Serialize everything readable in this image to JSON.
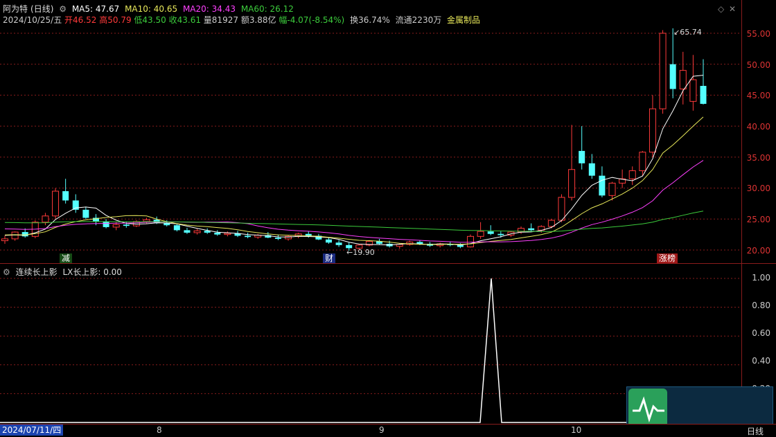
{
  "header": {
    "stock_name": "阿为特",
    "period": "(日线)",
    "ma5": "MA5: 47.67",
    "ma10": "MA10: 40.65",
    "ma20": "MA20: 34.43",
    "ma60": "MA60: 26.12",
    "date": "2024/10/25/五",
    "open": "开46.52",
    "high": "高50.79",
    "low": "低43.50",
    "close": "收43.61",
    "volume": "量81927",
    "amount": "额3.88亿",
    "change": "幅-4.07(-8.54%)",
    "turnover": "换36.74%",
    "float_shares": "流通2230万",
    "sector": "金属制品"
  },
  "price_axis": [
    "55.00",
    "50.00",
    "45.00",
    "40.00",
    "35.00",
    "30.00",
    "25.00",
    "20.00"
  ],
  "annotations": {
    "high_marker": "65.74",
    "low_marker": "19.90",
    "tag_jian": "减",
    "tag_cai": "财",
    "tag_zhangbang": "涨榜"
  },
  "indicator": {
    "title": "连续长上影",
    "lx_label": "LX长上影: 0.00",
    "axis": [
      "1.00",
      "0.80",
      "0.60",
      "0.40",
      "0.20"
    ]
  },
  "bottom_bar": {
    "start_date": "2024/07/11/四",
    "m8": "8",
    "m9": "9",
    "m10": "10",
    "period_btn": "日线"
  },
  "colors": {
    "up": "#ff3a3a",
    "down": "#54ffff",
    "ma5": "#ffffff",
    "ma10": "#e8e85a",
    "ma20": "#ff40ff",
    "ma60": "#3ccc3c",
    "grid": "#8a1c1c"
  },
  "chart_data": {
    "type": "candlestick",
    "candles_ohlc": [
      [
        21.5,
        22.3,
        21.0,
        21.8
      ],
      [
        21.8,
        23.0,
        21.5,
        22.9
      ],
      [
        22.9,
        23.5,
        22.0,
        22.2
      ],
      [
        22.2,
        24.8,
        21.9,
        24.5
      ],
      [
        24.5,
        26.0,
        24.0,
        25.5
      ],
      [
        25.5,
        30.0,
        25.0,
        29.5
      ],
      [
        29.5,
        31.5,
        27.5,
        28.0
      ],
      [
        28.0,
        29.0,
        26.0,
        26.5
      ],
      [
        26.5,
        27.0,
        25.0,
        25.2
      ],
      [
        25.2,
        25.8,
        24.0,
        24.6
      ],
      [
        24.6,
        25.0,
        23.5,
        23.7
      ],
      [
        23.7,
        24.5,
        23.2,
        24.1
      ],
      [
        24.1,
        24.6,
        23.6,
        23.9
      ],
      [
        23.9,
        24.8,
        23.7,
        24.6
      ],
      [
        24.6,
        25.2,
        24.3,
        24.9
      ],
      [
        24.9,
        25.4,
        24.2,
        24.4
      ],
      [
        24.4,
        24.8,
        23.8,
        24.0
      ],
      [
        24.0,
        24.3,
        23.0,
        23.2
      ],
      [
        23.2,
        23.6,
        22.6,
        22.8
      ],
      [
        22.8,
        23.4,
        22.5,
        23.1
      ],
      [
        23.1,
        23.5,
        22.6,
        22.8
      ],
      [
        22.8,
        23.2,
        22.3,
        22.5
      ],
      [
        22.5,
        23.0,
        22.2,
        22.7
      ],
      [
        22.7,
        23.1,
        22.1,
        22.3
      ],
      [
        22.3,
        22.8,
        21.9,
        22.1
      ],
      [
        22.1,
        22.6,
        21.8,
        22.4
      ],
      [
        22.4,
        22.9,
        21.9,
        22.0
      ],
      [
        22.0,
        22.5,
        21.6,
        21.8
      ],
      [
        21.8,
        22.4,
        21.5,
        22.2
      ],
      [
        22.2,
        22.8,
        21.9,
        22.6
      ],
      [
        22.6,
        23.0,
        22.0,
        22.3
      ],
      [
        22.3,
        22.6,
        21.6,
        21.7
      ],
      [
        21.7,
        22.0,
        21.0,
        21.2
      ],
      [
        21.2,
        21.6,
        20.5,
        20.8
      ],
      [
        20.8,
        21.2,
        19.9,
        20.3
      ],
      [
        20.3,
        21.0,
        20.0,
        20.8
      ],
      [
        20.8,
        21.6,
        20.6,
        21.4
      ],
      [
        21.4,
        21.8,
        20.9,
        21.0
      ],
      [
        21.0,
        21.5,
        20.4,
        20.6
      ],
      [
        20.6,
        21.1,
        20.2,
        20.9
      ],
      [
        20.9,
        21.5,
        20.7,
        21.3
      ],
      [
        21.3,
        21.6,
        20.8,
        21.0
      ],
      [
        21.0,
        21.3,
        20.5,
        20.7
      ],
      [
        20.7,
        21.2,
        20.4,
        21.0
      ],
      [
        21.0,
        21.3,
        20.6,
        20.8
      ],
      [
        20.8,
        21.1,
        20.3,
        20.5
      ],
      [
        20.5,
        22.5,
        20.4,
        22.2
      ],
      [
        22.2,
        24.5,
        21.8,
        23.0
      ],
      [
        23.0,
        24.0,
        22.4,
        22.6
      ],
      [
        22.6,
        23.0,
        22.0,
        22.4
      ],
      [
        22.4,
        23.1,
        22.1,
        22.9
      ],
      [
        22.9,
        23.8,
        22.6,
        23.5
      ],
      [
        23.5,
        24.3,
        23.0,
        23.2
      ],
      [
        23.2,
        24.0,
        22.8,
        23.8
      ],
      [
        23.8,
        25.0,
        23.5,
        24.8
      ],
      [
        24.8,
        29.0,
        24.5,
        28.5
      ],
      [
        28.5,
        40.2,
        28.0,
        33.0
      ],
      [
        36.0,
        40.0,
        33.0,
        34.0
      ],
      [
        34.0,
        35.5,
        31.5,
        32.0
      ],
      [
        32.0,
        33.5,
        28.5,
        28.8
      ],
      [
        28.8,
        31.0,
        28.0,
        30.8
      ],
      [
        30.8,
        33.0,
        30.0,
        31.5
      ],
      [
        31.5,
        33.5,
        30.5,
        32.8
      ],
      [
        32.8,
        36.0,
        32.0,
        35.8
      ],
      [
        35.8,
        45.0,
        35.0,
        42.8
      ],
      [
        42.8,
        55.5,
        42.0,
        55.0
      ],
      [
        50.0,
        55.8,
        44.5,
        46.0
      ],
      [
        46.0,
        52.0,
        43.5,
        49.0
      ],
      [
        44.0,
        51.5,
        42.5,
        47.5
      ],
      [
        46.5,
        50.8,
        43.5,
        43.6
      ]
    ],
    "ma_lines": [
      {
        "name": "MA5",
        "last": 47.67
      },
      {
        "name": "MA10",
        "last": 40.65
      },
      {
        "name": "MA20",
        "last": 34.43
      },
      {
        "name": "MA60",
        "last": 26.12
      }
    ],
    "indicator_series": {
      "name": "LX长上影",
      "peak": 1.0,
      "ylim": [
        0,
        1
      ]
    }
  }
}
